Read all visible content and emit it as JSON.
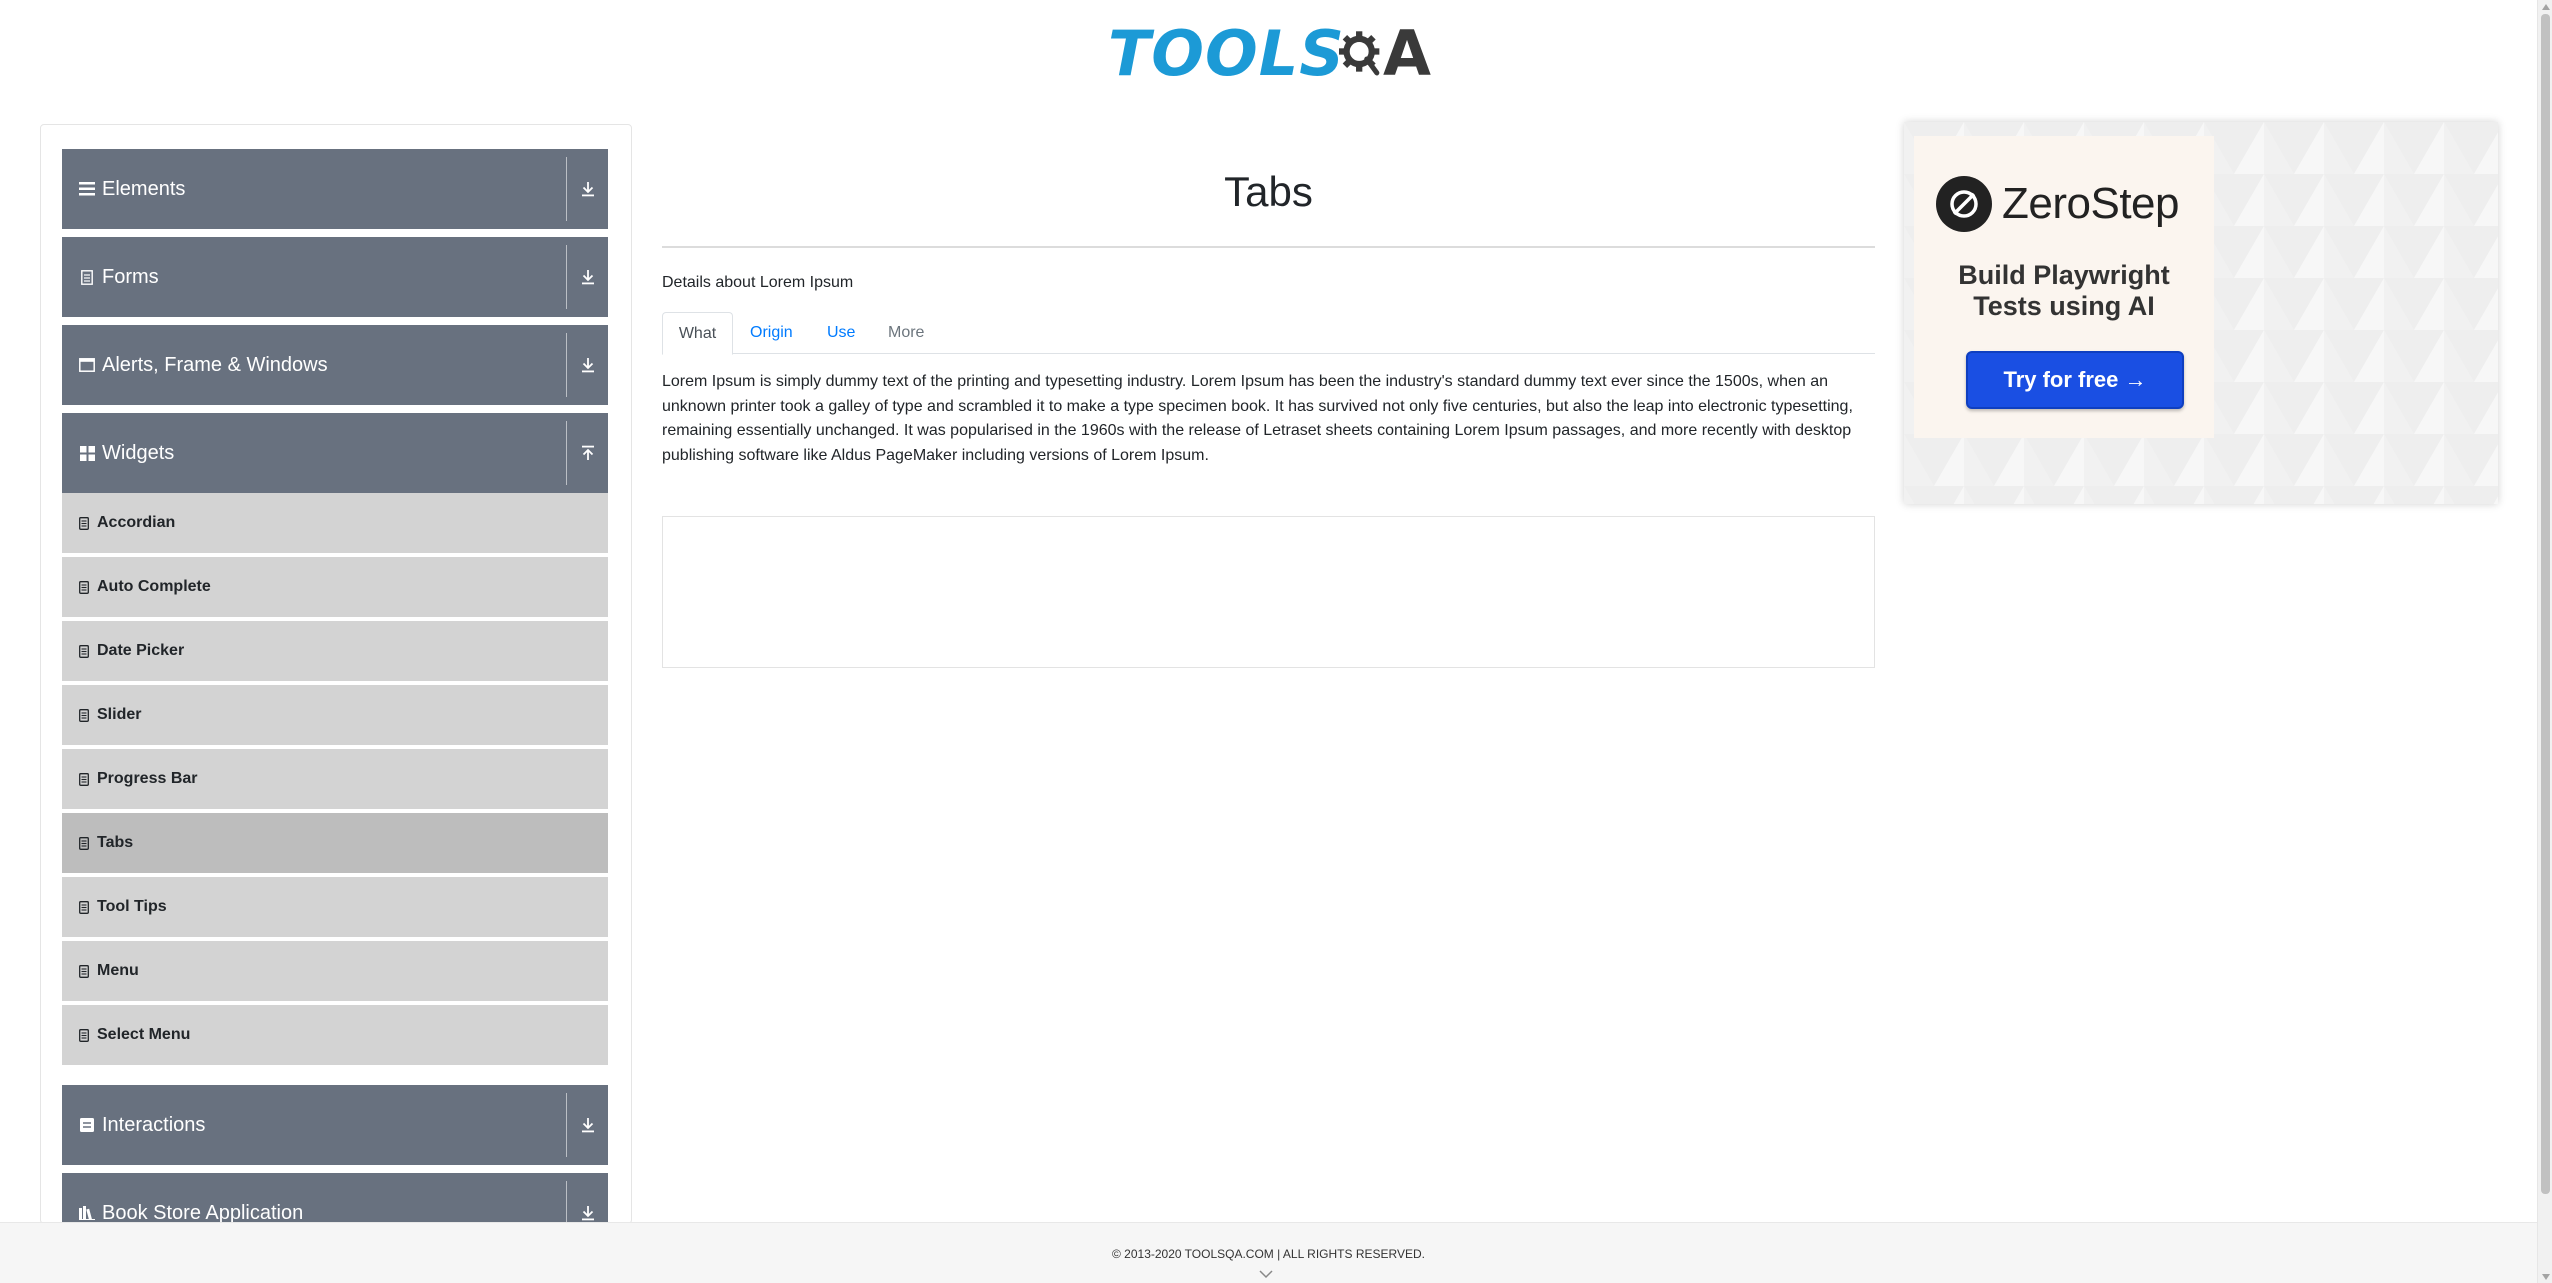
{
  "header": {
    "logo_tools": "TOOLS",
    "logo_qa": "A"
  },
  "sidebar": {
    "groups": [
      {
        "label": "Elements",
        "icon": "hamburger-icon",
        "expanded": false
      },
      {
        "label": "Forms",
        "icon": "document-icon",
        "expanded": false
      },
      {
        "label": "Alerts, Frame & Windows",
        "icon": "window-icon",
        "expanded": false
      },
      {
        "label": "Widgets",
        "icon": "widgets-icon",
        "expanded": true
      },
      {
        "label": "Interactions",
        "icon": "interactions-icon",
        "expanded": false
      },
      {
        "label": "Book Store Application",
        "icon": "books-icon",
        "expanded": false
      }
    ],
    "widget_items": [
      {
        "label": "Accordian"
      },
      {
        "label": "Auto Complete"
      },
      {
        "label": "Date Picker"
      },
      {
        "label": "Slider"
      },
      {
        "label": "Progress Bar"
      },
      {
        "label": "Tabs",
        "active": true
      },
      {
        "label": "Tool Tips"
      },
      {
        "label": "Menu"
      },
      {
        "label": "Select Menu"
      }
    ]
  },
  "main": {
    "title": "Tabs",
    "details": "Details about Lorem Ipsum",
    "tabs": [
      {
        "label": "What",
        "state": "active"
      },
      {
        "label": "Origin",
        "state": "link"
      },
      {
        "label": "Use",
        "state": "link"
      },
      {
        "label": "More",
        "state": "disabled"
      }
    ],
    "content": "Lorem Ipsum is simply dummy text of the printing and typesetting industry. Lorem Ipsum has been the industry's standard dummy text ever since the 1500s, when an unknown printer took a galley of type and scrambled it to make a type specimen book. It has survived not only five centuries, but also the leap into electronic typesetting, remaining essentially unchanged. It was popularised in the 1960s with the release of Letraset sheets containing Lorem Ipsum passages, and more recently with desktop publishing software like Aldus PageMaker including versions of Lorem Ipsum."
  },
  "banner": {
    "brand": "ZeroStep",
    "tagline_line1": "Build Playwright",
    "tagline_line2": "Tests using AI",
    "cta": "Try for free →"
  },
  "footer": {
    "copyright": "© 2013-2020 TOOLSQA.COM | ALL RIGHTS RESERVED."
  },
  "colors": {
    "group_header_bg": "#68717f",
    "menu_item_bg": "#d3d3d3",
    "menu_item_active_bg": "#bdbdbd",
    "link": "#007bff",
    "logo_blue": "#1c9ad6",
    "cta_blue": "#1a4fe3"
  }
}
